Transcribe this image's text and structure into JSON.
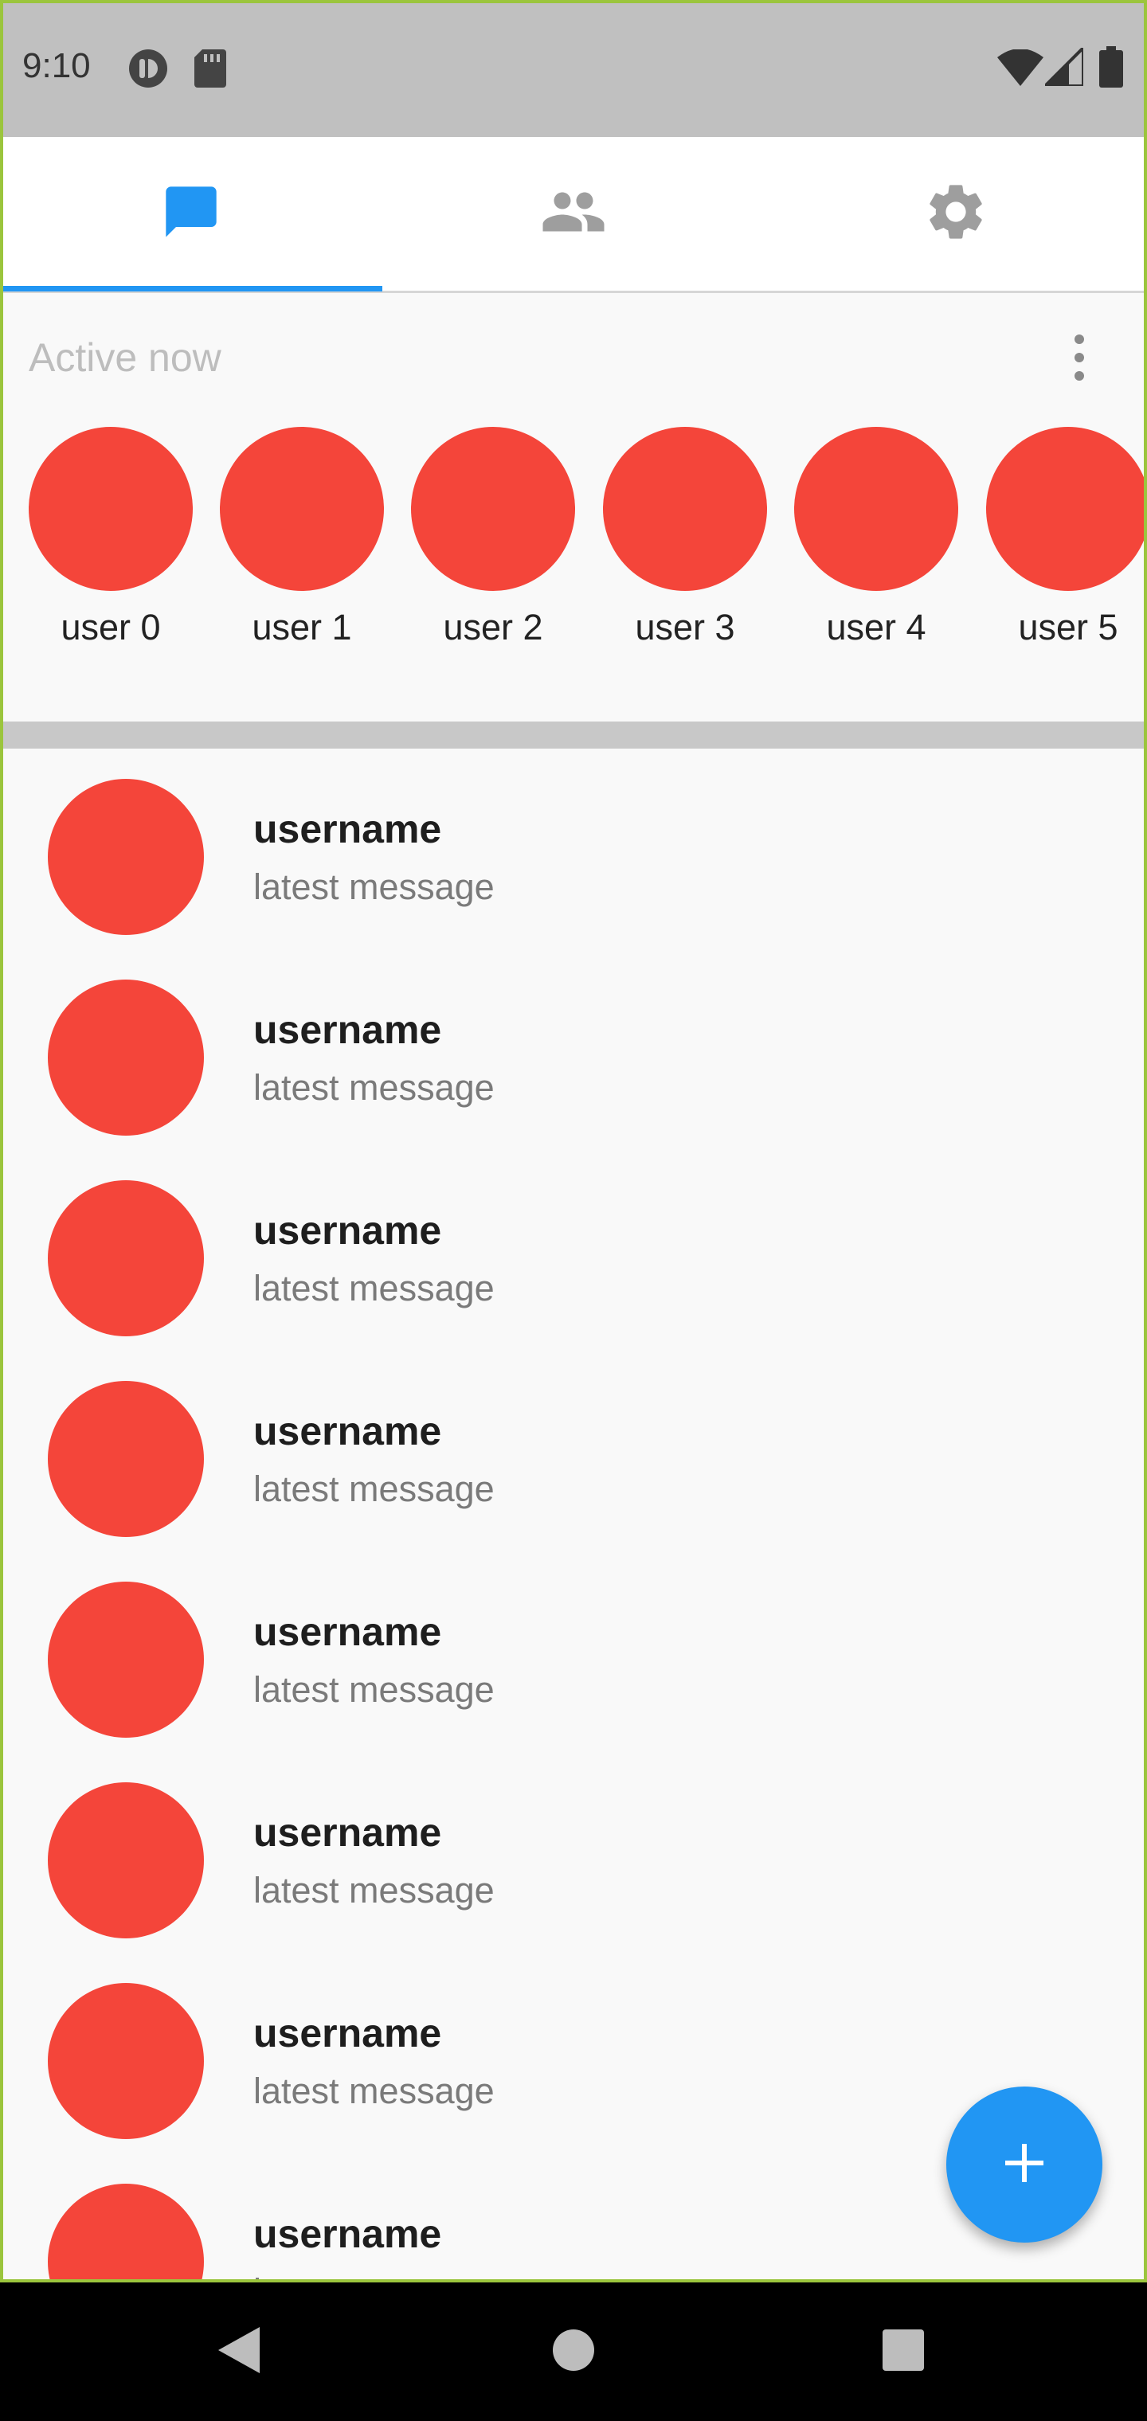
{
  "status_bar": {
    "time": "9:10",
    "left_icons": [
      "notification-app-icon",
      "sd-card-icon"
    ],
    "right_icons": [
      "wifi-icon",
      "cell-signal-icon",
      "battery-icon"
    ]
  },
  "tabs": [
    {
      "icon": "chat-icon",
      "active": true
    },
    {
      "icon": "people-icon",
      "active": false
    },
    {
      "icon": "gear-icon",
      "active": false
    }
  ],
  "active_now": {
    "title": "Active now",
    "users": [
      "user 0",
      "user 1",
      "user 2",
      "user 3",
      "user 4",
      "user 5"
    ]
  },
  "conversations": [
    {
      "username": "username",
      "message": "latest message"
    },
    {
      "username": "username",
      "message": "latest message"
    },
    {
      "username": "username",
      "message": "latest message"
    },
    {
      "username": "username",
      "message": "latest message"
    },
    {
      "username": "username",
      "message": "latest message"
    },
    {
      "username": "username",
      "message": "latest message"
    },
    {
      "username": "username",
      "message": "latest message"
    },
    {
      "username": "username",
      "message": "latest message"
    }
  ],
  "fab": {
    "icon": "plus-icon"
  },
  "nav": [
    "back-icon",
    "home-icon",
    "recents-icon"
  ],
  "colors": {
    "accent": "#2196f3",
    "avatar": "#f4453a",
    "status_bar": "#c0c0c0",
    "tab_icon_inactive": "#9e9e9e"
  }
}
